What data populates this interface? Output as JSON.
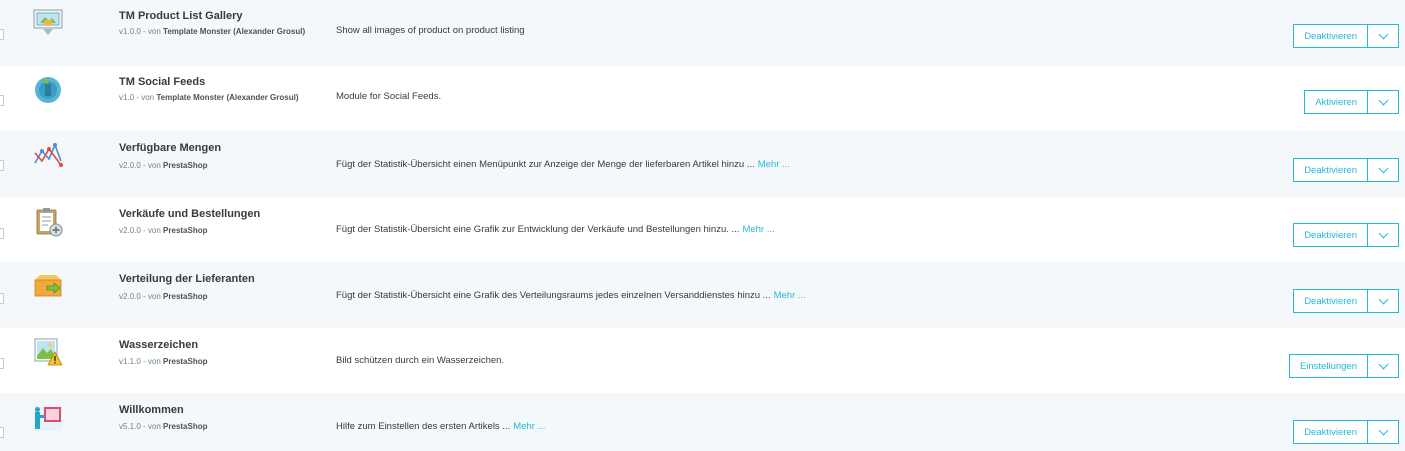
{
  "modules": [
    {
      "name": "TM Product List Gallery",
      "version": "v1.0.0",
      "by": "von",
      "author": "Template Monster (Alexander Grosul)",
      "description": "Show all images of product on product listing",
      "more": "",
      "action": "Deaktivieren",
      "icon": "gallery-icon"
    },
    {
      "name": "TM Social Feeds",
      "version": "v1.0",
      "by": "von",
      "author": "Template Monster (Alexander Grosul)",
      "description": "Module for Social Feeds.",
      "more": "",
      "action": "Aktivieren",
      "icon": "social-feeds-icon"
    },
    {
      "name": "Verfügbare Mengen",
      "version": "v2.0.0",
      "by": "von",
      "author": "PrestaShop",
      "description": "Fügt der Statistik-Übersicht einen Menüpunkt zur Anzeige der Menge der lieferbaren Artikel hinzu ...",
      "more": "Mehr ...",
      "action": "Deaktivieren",
      "icon": "line-chart-icon"
    },
    {
      "name": "Verkäufe und Bestellungen",
      "version": "v2.0.0",
      "by": "von",
      "author": "PrestaShop",
      "description": "Fügt der Statistik-Übersicht eine Grafik zur Entwicklung der Verkäufe und Bestellungen hinzu. ...",
      "more": "Mehr ...",
      "action": "Deaktivieren",
      "icon": "clipboard-icon"
    },
    {
      "name": "Verteilung der Lieferanten",
      "version": "v2.0.0",
      "by": "von",
      "author": "PrestaShop",
      "description": "Fügt der Statistik-Übersicht eine Grafik des Verteilungsraums jedes einzelnen Versanddienstes hinzu ...",
      "more": "Mehr ...",
      "action": "Deaktivieren",
      "icon": "box-arrow-icon"
    },
    {
      "name": "Wasserzeichen",
      "version": "v1.1.0",
      "by": "von",
      "author": "PrestaShop",
      "description": "Bild schützen durch ein Wasserzeichen.",
      "more": "",
      "action": "Einstellungen",
      "icon": "watermark-icon"
    },
    {
      "name": "Willkommen",
      "version": "v5.1.0",
      "by": "von",
      "author": "PrestaShop",
      "description": "Hilfe zum Einstellen des ersten Artikels ...",
      "more": "Mehr ...",
      "action": "Deaktivieren",
      "icon": "welcome-icon"
    }
  ]
}
